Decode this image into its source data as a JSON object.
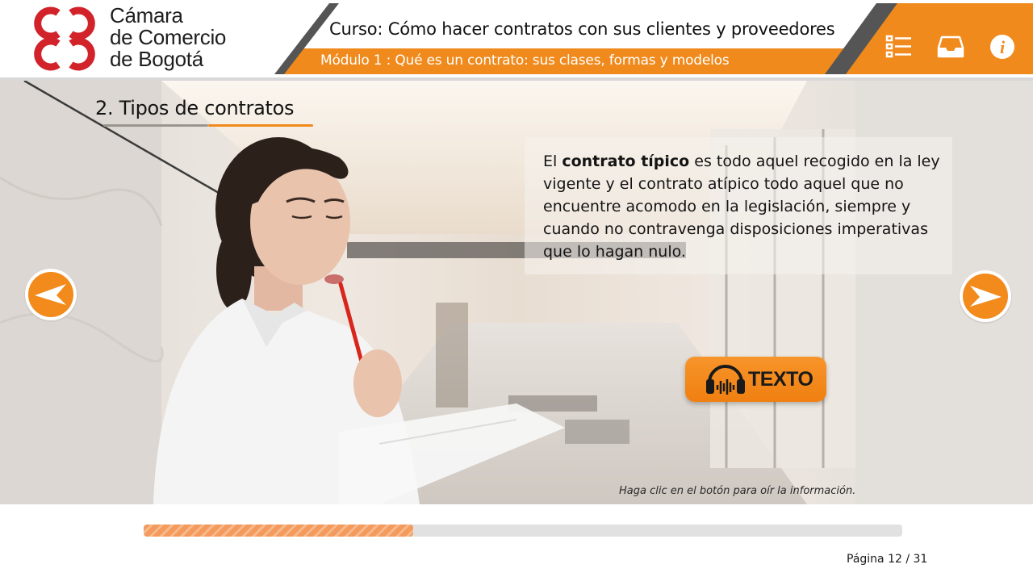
{
  "header": {
    "logo_lines": [
      "Cámara",
      "de Comercio",
      "de Bogotá"
    ],
    "course_title": "Curso: Cómo hacer contratos con sus clientes y proveedores",
    "module_title": "Módulo 1 : Qué es un contrato: sus clases, formas y modelos",
    "icons": [
      "menu-list-icon",
      "inbox-icon",
      "info-icon"
    ]
  },
  "content": {
    "section_title": "2. Tipos de contratos",
    "paragraph": {
      "bold": "contrato típico",
      "before": "El ",
      "after": " es todo aquel recogido en la ley vigente y el contrato atípico todo aquel que no encuentre acomodo en la legislación, siempre y cuando no contravenga disposiciones imperativas que lo hagan nulo."
    },
    "audio_button_label": "TEXTO",
    "hint": "Haga clic en el botón para oír la información."
  },
  "navigation": {
    "prev_icon": "arrow-left-icon",
    "next_icon": "arrow-right-icon"
  },
  "footer": {
    "progress_fraction": 0.355,
    "page_text": "Página 12  / 31"
  },
  "colors": {
    "accent": "#f08a1c",
    "logo_red": "#d2232a",
    "header_dark": "#555555"
  }
}
